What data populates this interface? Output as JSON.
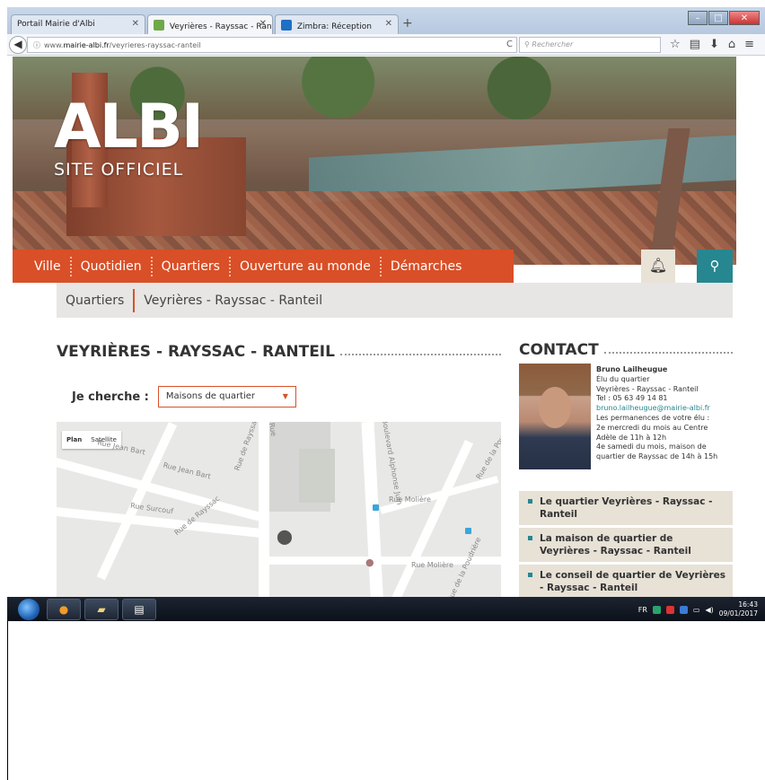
{
  "browser": {
    "tabs": [
      {
        "label": "Portail Mairie d'Albi",
        "active": false
      },
      {
        "label": "Veyrières - Rayssac - Rantei...",
        "active": true
      },
      {
        "label": "Zimbra: Réception",
        "active": false
      }
    ],
    "new_tab": "+",
    "url_prefix": "www.",
    "url_domain": "mairie-albi.fr",
    "url_path": "/veyrieres-rayssac-ranteil",
    "search_placeholder": "Rechercher"
  },
  "site": {
    "logo_title": "ALBI",
    "logo_subtitle": "SITE OFFICIEL",
    "nav": [
      "Ville",
      "Quotidien",
      "Quartiers",
      "Ouverture au monde",
      "Démarches"
    ],
    "accent_color": "#d94f27",
    "teal_color": "#268790"
  },
  "breadcrumb": [
    "Quartiers",
    "Veyrières - Rayssac - Ranteil"
  ],
  "page": {
    "title": "VEYRIÈRES - RAYSSAC - RANTEIL",
    "search_label": "Je cherche :",
    "select_value": "Maisons de quartier"
  },
  "map": {
    "type_plan": "Plan",
    "type_satellite": "Satellite",
    "streets": [
      "Rue Jean Bart",
      "Rue Jean Bart",
      "Rue Surcouf",
      "Rue de Rayssac",
      "Rue de Rayssac",
      "Rue Molière",
      "Rue Molière",
      "Rue de la Poudrière",
      "Rue de la Poudrière",
      "Boulevard Alphonse Juin",
      "Rue"
    ]
  },
  "contact": {
    "title": "CONTACT",
    "name": "Bruno Lailheugue",
    "role": "Élu du quartier",
    "area": "Veyrières - Rayssac - Ranteil",
    "tel": "Tel : 05 63 49 14 81",
    "email": "bruno.lailheugue@mairie-albi.fr",
    "perm_1": "Les permanences de votre élu :",
    "perm_2": "2e mercredi du mois au Centre",
    "perm_3": "Adèle de 11h à 12h",
    "perm_4": "4e samedi du mois, maison de",
    "perm_5": "quartier de Rayssac de 14h à 15h",
    "links": [
      "Le quartier Veyrières - Rayssac - Ranteil",
      "La maison de quartier de Veyrières - Rayssac - Ranteil",
      "Le conseil de quartier de Veyrières - Rayssac - Ranteil"
    ]
  },
  "taskbar": {
    "lang": "FR",
    "time": "16:43",
    "date": "09/01/2017"
  }
}
